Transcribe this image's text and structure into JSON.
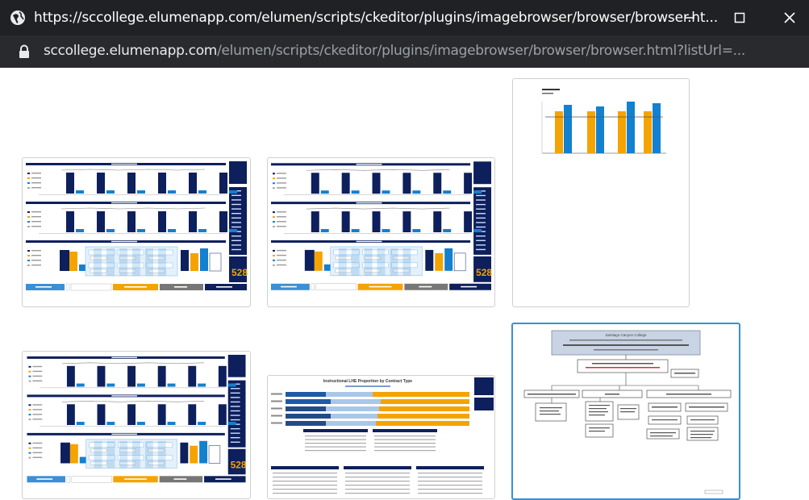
{
  "window": {
    "title": "https://sccollege.elumenapp.com/elumen/scripts/ckeditor/plugins/imagebrowser/browser/browser.ht...",
    "controls": [
      "minimize-icon",
      "maximize-icon",
      "close-icon"
    ]
  },
  "address_bar": {
    "host": "sccollege.elumenapp.com",
    "path": "/elumen/scripts/ckeditor/plugins/imagebrowser/browser/browser.html?listUrl=..."
  },
  "thumbnails": [
    {
      "kind": "dashboard",
      "badge": "528"
    },
    {
      "kind": "dashboard",
      "badge": "528"
    },
    {
      "kind": "bar-chart"
    },
    {
      "kind": "dashboard",
      "badge": "528"
    },
    {
      "kind": "proportion-report",
      "heading": "Instructional LHE Proportion by Contract Type"
    },
    {
      "kind": "org-chart",
      "selected": true,
      "heading": "Santiago Canyon College"
    }
  ],
  "colors": {
    "titlebar": "#202124",
    "addrbar": "#292a2d",
    "navy": "#0d1f5c",
    "orange": "#f5a300",
    "blue": "#1380d0",
    "selected_border": "#3a8fd6"
  }
}
